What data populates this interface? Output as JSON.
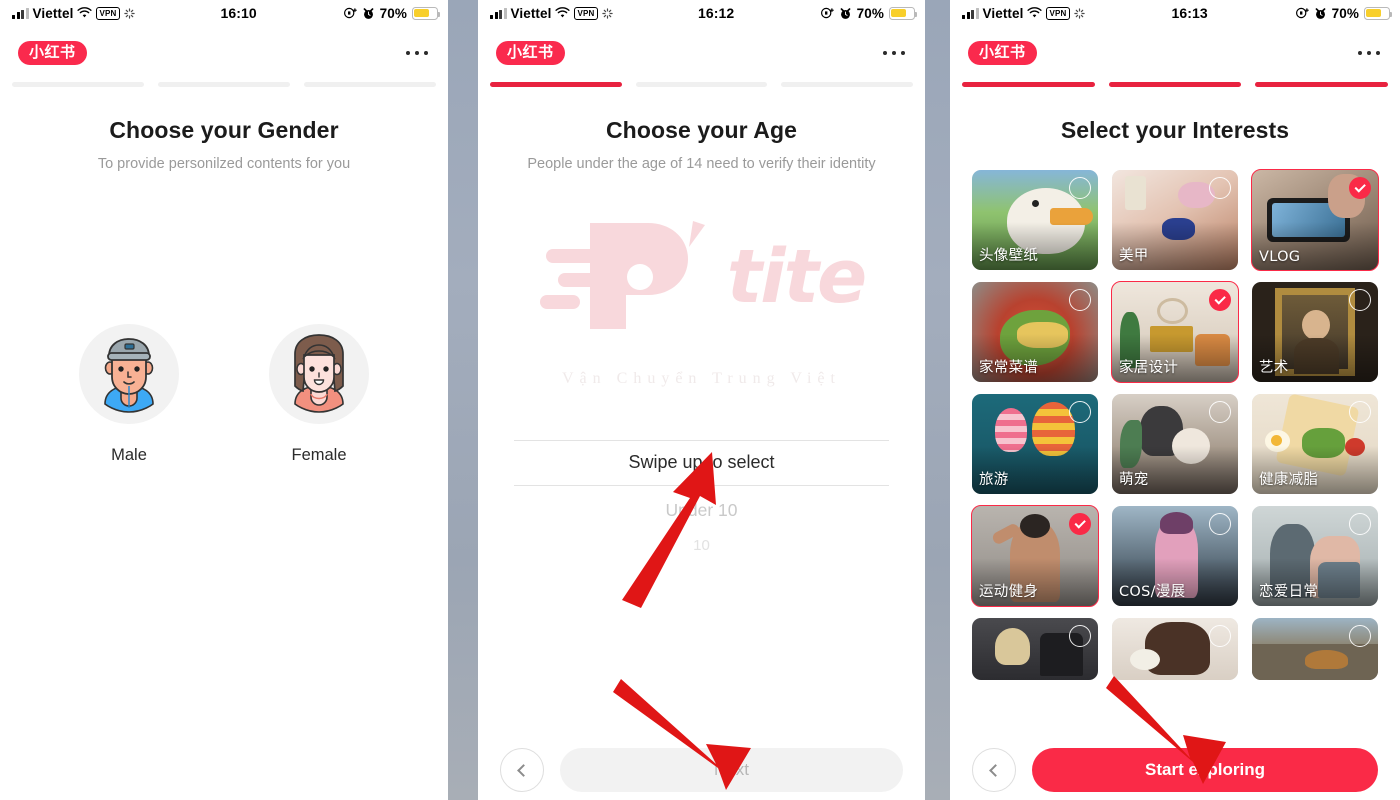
{
  "brand": {
    "logo_text": "小红书",
    "accent": "#fa2a47",
    "progress_active": "#e8223f"
  },
  "panels": [
    {
      "status": {
        "carrier": "Viettel",
        "vpn": "VPN",
        "time": "16:10",
        "battery_pct": "70%"
      },
      "progress": [
        false,
        false,
        false
      ],
      "title": "Choose your Gender",
      "subtitle": "To provide personilzed contents for you",
      "genders": [
        {
          "label": "Male",
          "icon": "male-avatar-icon"
        },
        {
          "label": "Female",
          "icon": "female-avatar-icon"
        }
      ]
    },
    {
      "status": {
        "carrier": "Viettel",
        "vpn": "VPN",
        "time": "16:12",
        "battery_pct": "70%"
      },
      "progress": [
        true,
        false,
        false
      ],
      "title": "Choose your Age",
      "subtitle": "People under the age of 14 need to verify their identity",
      "picker": {
        "selected": "Swipe up to select",
        "below_1": "Under 10",
        "below_2": "10"
      },
      "watermark": {
        "main": "tite",
        "apostrophe": "'",
        "sub": "Vận Chuyển Trung Việt"
      },
      "cta": {
        "label": "Next",
        "enabled": false
      },
      "back": "back-button"
    },
    {
      "status": {
        "carrier": "Viettel",
        "vpn": "VPN",
        "time": "16:13",
        "battery_pct": "70%"
      },
      "progress": [
        true,
        true,
        true
      ],
      "title": "Select your Interests",
      "cta": {
        "label": "Start exploring",
        "enabled": true
      },
      "back": "back-button",
      "interests": [
        {
          "label": "头像壁纸",
          "selected": false
        },
        {
          "label": "美甲",
          "selected": false
        },
        {
          "label": "VLOG",
          "selected": true
        },
        {
          "label": "家常菜谱",
          "selected": false
        },
        {
          "label": "家居设计",
          "selected": true
        },
        {
          "label": "艺术",
          "selected": false
        },
        {
          "label": "旅游",
          "selected": false
        },
        {
          "label": "萌宠",
          "selected": false
        },
        {
          "label": "健康减脂",
          "selected": false
        },
        {
          "label": "运动健身",
          "selected": true
        },
        {
          "label": "COS/漫展",
          "selected": false
        },
        {
          "label": "恋爱日常",
          "selected": false
        },
        {
          "label": "",
          "selected": false
        },
        {
          "label": "",
          "selected": false
        },
        {
          "label": "",
          "selected": false
        }
      ]
    }
  ]
}
